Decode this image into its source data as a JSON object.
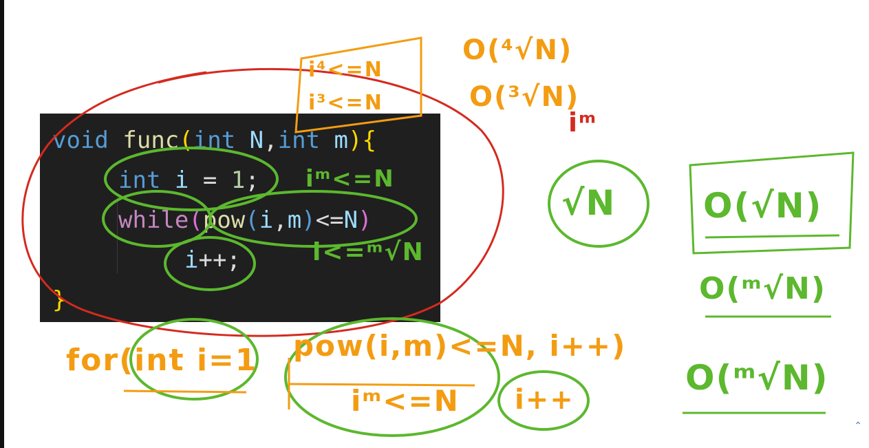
{
  "code": {
    "line1": {
      "kw": "void",
      "fn": "func",
      "lp": "(",
      "t1": "int",
      "v1": "N",
      "c": ",",
      "t2": "int",
      "v2": "m",
      "rp": ")",
      "lb": "{"
    },
    "line2": {
      "t": "int",
      "v": "i",
      "eq": "=",
      "n": "1",
      "s": ";"
    },
    "line3": {
      "kw": "while",
      "lp": "(",
      "fn": "pow",
      "lp2": "(",
      "a": "i",
      "c": ",",
      "b": "m",
      "rp2": ")",
      "op": "<=",
      "v": "N",
      "rp": ")"
    },
    "line4": {
      "v": "i",
      "op": "++;"
    },
    "line5": {
      "rb": "}"
    }
  },
  "annotations": {
    "i4": "i⁴<=N",
    "i3": "i³<=N",
    "o4": "O(⁴√N)",
    "o3": "O(³√N)",
    "im_red": "iᵐ",
    "im_code": "iᵐ<=N",
    "i_root": "i<=ᵐ√N",
    "sqrtN": "√N",
    "o_sqrt": "O(√N)",
    "o_msqrt1": "O(ᵐ√N)",
    "o_msqrt2": "O(ᵐ√N)",
    "for_head": "for(int i=1",
    "for_cond": "pow(i,m)<=N, i++)",
    "im_under": "iᵐ<=N",
    "ipp": "i++"
  },
  "colors": {
    "orange": "#f39c12",
    "green": "#5cb82e",
    "red": "#d42a1f"
  },
  "scroll_icon": "chevron-up-icon",
  "scroll_glyph": "⌃"
}
